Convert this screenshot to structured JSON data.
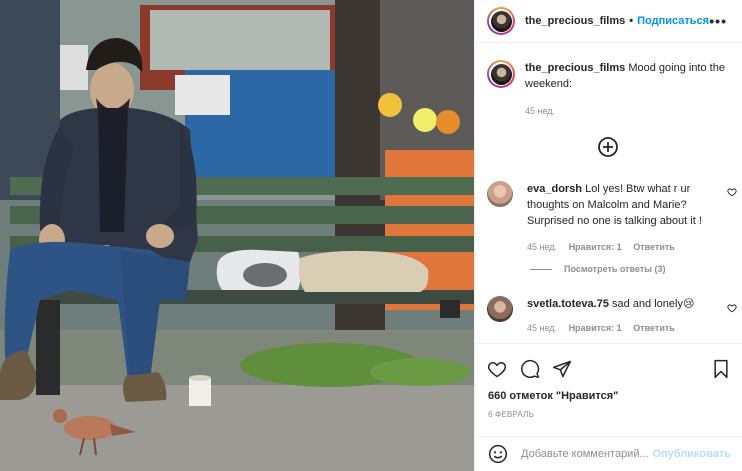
{
  "header": {
    "username": "the_precious_films",
    "separator": "•",
    "follow_label": "Подписаться",
    "more_label": "•••"
  },
  "caption": {
    "username": "the_precious_films",
    "text": "Mood going into the weekend:",
    "time": "45 нед."
  },
  "load_more_icon": "plus-circle-icon",
  "comments": [
    {
      "username": "eva_dorsh",
      "text": "Lol yes! Btw what r ur thoughts on Malcolm and Marie? Surprised no one is talking about it !",
      "time": "45 нед.",
      "likes_label": "Нравится: 1",
      "reply_label": "Ответить",
      "view_replies_label": "Посмотреть ответы (3)"
    },
    {
      "username": "svetla.toteva.75",
      "text": "sad and lonely😢",
      "time": "45 нед.",
      "likes_label": "Нравится: 1",
      "reply_label": "Ответить"
    }
  ],
  "actions": {
    "icons": [
      "heart-icon",
      "comment-icon",
      "share-icon",
      "bookmark-icon"
    ]
  },
  "likes_label": "660 отметок \"Нравится\"",
  "date_label": "6 ФЕВРАЛЬ",
  "add_comment": {
    "placeholder": "Добавьте комментарий...",
    "publish_label": "Опубликовать",
    "emoji_icon": "smiley-icon"
  },
  "colors": {
    "accent": "#0095f6",
    "publish_disabled": "#b2dffc",
    "secondary_text": "#8e8e8e",
    "primary_text": "#262626"
  }
}
